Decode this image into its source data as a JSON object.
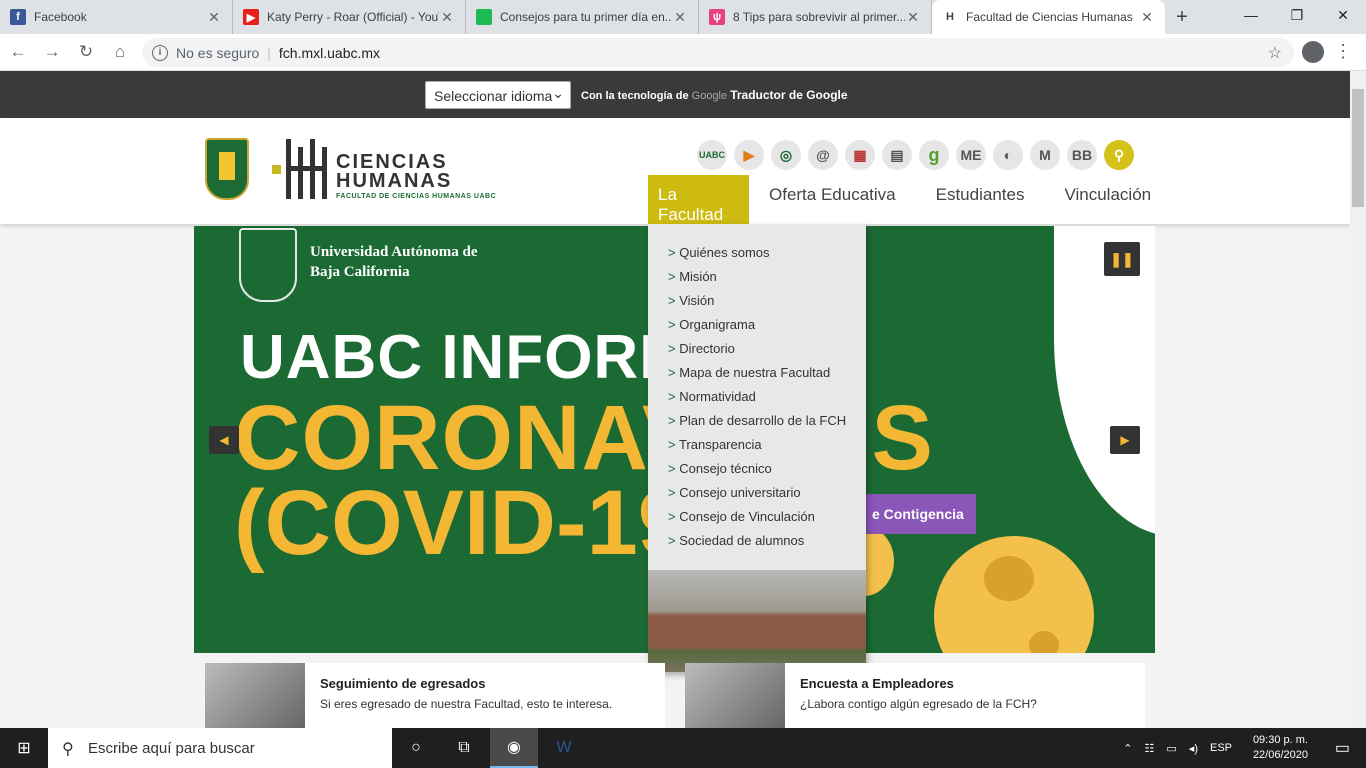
{
  "tabs": [
    {
      "title": "Facebook",
      "favicon": "facebook-icon",
      "color": "#3b5998"
    },
    {
      "title": "Katy Perry - Roar (Official) - YouTube",
      "favicon": "youtube-icon",
      "color": "#e62117"
    },
    {
      "title": "Consejos para tu primer día en...",
      "favicon": "doc-icon",
      "color": "#1db954"
    },
    {
      "title": "8 Tips para sobrevivir al primer...",
      "favicon": "tips-icon",
      "color": "#e8417c"
    },
    {
      "title": "Facultad de Ciencias Humanas",
      "favicon": "fch-icon",
      "color": "#444"
    }
  ],
  "address": {
    "security": "No es seguro",
    "url": "fch.mxl.uabc.mx"
  },
  "translate": {
    "select_label": "Seleccionar idioma",
    "powered": "Con la tecnología de",
    "google": "Google",
    "service": "Traductor de Google"
  },
  "logo": {
    "line1": "CIENCIAS",
    "line2": "HUMANAS",
    "sub": "FACULTAD DE CIENCIAS HUMANAS UABC"
  },
  "quick_icons": [
    "UABC",
    "▶",
    "◎",
    "@",
    "▦",
    "▤",
    "g",
    "ME",
    "◐",
    "M",
    "BB"
  ],
  "nav": [
    "La Facultad",
    "Oferta Educativa",
    "Estudiantes",
    "Vinculación"
  ],
  "dropdown": [
    "Quiénes somos",
    "Misión",
    "Visión",
    "Organigrama",
    "Directorio",
    "Mapa de nuestra Facultad",
    "Normatividad",
    "Plan de desarrollo de la FCH",
    "Transparencia",
    "Consejo técnico",
    "Consejo universitario",
    "Consejo de Vinculación",
    "Sociedad de alumnos"
  ],
  "banner": {
    "university": "Universidad Autónoma de Baja California",
    "line1": "UABC INFORM",
    "line2": "CORONAV",
    "line2b": "US",
    "line3": "(COVID-19)",
    "button": "e Contigencia"
  },
  "cards": [
    {
      "title": "Seguimiento de egresados",
      "desc": "Si eres egresado de nuestra Facultad, esto te interesa."
    },
    {
      "title": "Encuesta a Empleadores",
      "desc": "¿Labora contigo algún egresado de la FCH?"
    }
  ],
  "taskbar": {
    "search": "Escribe aquí para buscar",
    "lang": "ESP",
    "time": "09:30 p. m.",
    "date": "22/06/2020"
  }
}
